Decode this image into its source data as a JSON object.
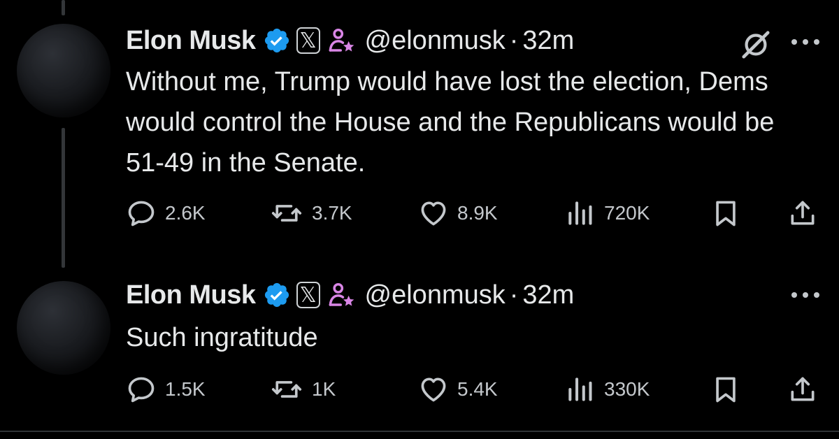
{
  "tweets": [
    {
      "author": "Elon Musk",
      "handle": "@elonmusk",
      "separator": "·",
      "time": "32m",
      "text": "Without me, Trump would have lost the election, Dems would control the House and the Republicans would be 51-49 in the Senate.",
      "stats": {
        "replies": "2.6K",
        "retweets": "3.7K",
        "likes": "8.9K",
        "views": "720K"
      }
    },
    {
      "author": "Elon Musk",
      "handle": "@elonmusk",
      "separator": "·",
      "time": "32m",
      "text": "Such ingratitude",
      "stats": {
        "replies": "1.5K",
        "retweets": "1K",
        "likes": "5.4K",
        "views": "330K"
      }
    }
  ],
  "badges": {
    "x_badge_glyph": "𝕏",
    "verified_color": "#1d9bf0",
    "affiliate_color": "#d986e6"
  },
  "colors": {
    "background": "#000000",
    "text": "#e7e9ea",
    "icon": "#c4c8cc"
  }
}
